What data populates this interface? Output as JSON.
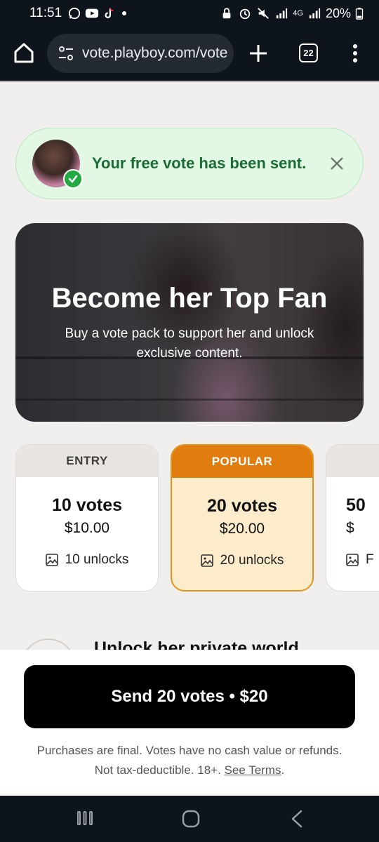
{
  "status_bar": {
    "time": "11:51",
    "battery": "20%",
    "network": "4G",
    "left_icons": [
      "whatsapp-icon",
      "youtube-icon",
      "tiktok-icon"
    ],
    "right_icons": [
      "lock-icon",
      "alarm-icon",
      "mute-icon",
      "signal-icon",
      "battery-icon"
    ]
  },
  "browser": {
    "url": "vote.playboy.com/vote",
    "tab_count": "22"
  },
  "toast": {
    "message": "Your free vote has been sent."
  },
  "hero": {
    "title": "Become her Top Fan",
    "subtitle": "Buy a vote pack to support her and unlock exclusive content."
  },
  "packs": [
    {
      "tier": "ENTRY",
      "votes": "10 votes",
      "price": "$10.00",
      "unlocks": "10 unlocks",
      "selected": false
    },
    {
      "tier": "POPULAR",
      "votes": "20 votes",
      "price": "$20.00",
      "unlocks": "20 unlocks",
      "selected": true
    },
    {
      "tier": "",
      "votes": "50",
      "price": "$",
      "unlocks": "F",
      "selected": false
    }
  ],
  "next_section": {
    "title": "Unlock her private world"
  },
  "cta": {
    "label": "Send 20 votes • $20"
  },
  "disclaimer": {
    "line1": "Purchases are final. Votes have no cash value or refunds.",
    "line2_prefix": "Not tax-deductible. 18+. ",
    "terms_link": "See Terms",
    "line2_suffix": "."
  },
  "colors": {
    "toast_bg": "#e2f8e4",
    "toast_text": "#1b6b34",
    "popular_accent": "#e07d0e",
    "popular_bg": "#fdeccc",
    "cta_bg": "#000000",
    "page_bg": "#f1efed"
  }
}
